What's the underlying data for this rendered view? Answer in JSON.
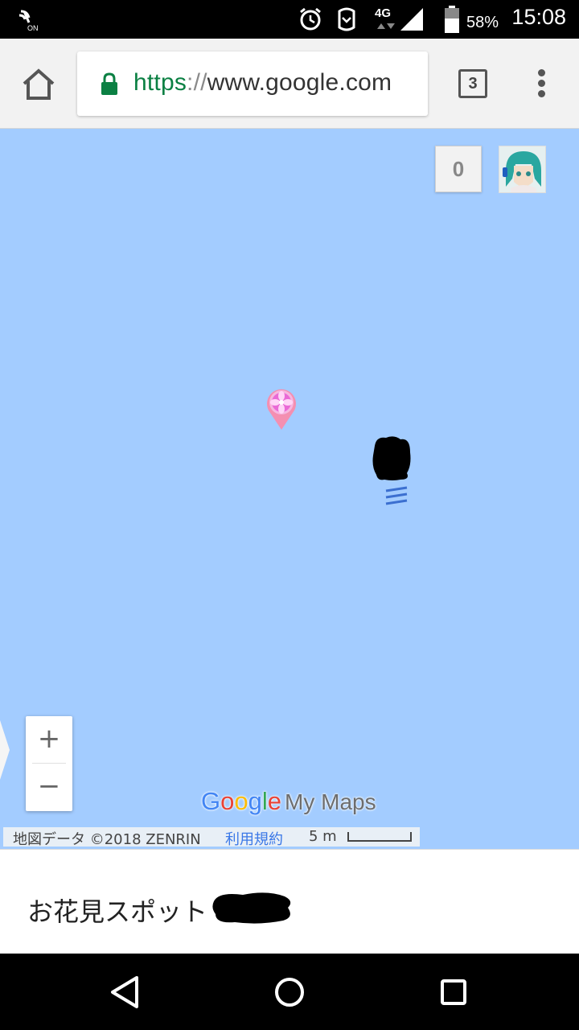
{
  "status_bar": {
    "network_type": "4G",
    "battery_percent": "58%",
    "time": "15:08",
    "icons": [
      "nfc-on-icon",
      "alarm-icon",
      "vibrate-icon",
      "signal-icon",
      "battery-icon"
    ],
    "nfc_label": "ON"
  },
  "browser": {
    "url_scheme": "https",
    "url_separator": "://",
    "url_host": "www.google.com",
    "tab_count": "3"
  },
  "map": {
    "score": "0",
    "zoom_in_label": "+",
    "zoom_out_label": "−",
    "logo_google": [
      "G",
      "o",
      "o",
      "g",
      "l",
      "e"
    ],
    "logo_google_colors": [
      "#4285f4",
      "#ea4335",
      "#fbbc05",
      "#4285f4",
      "#34a853",
      "#ea4335"
    ],
    "logo_product": "My Maps",
    "attribution": "地図データ ©2018 ZENRIN",
    "terms_link": "利用規約",
    "scale_label": "5 m",
    "water_color": "#a3ccff",
    "pin_color": "#f48fb1"
  },
  "info_panel": {
    "title": "お花見スポット"
  },
  "nav_bar": {
    "icons": [
      "back-icon",
      "home-icon",
      "recents-icon"
    ]
  }
}
